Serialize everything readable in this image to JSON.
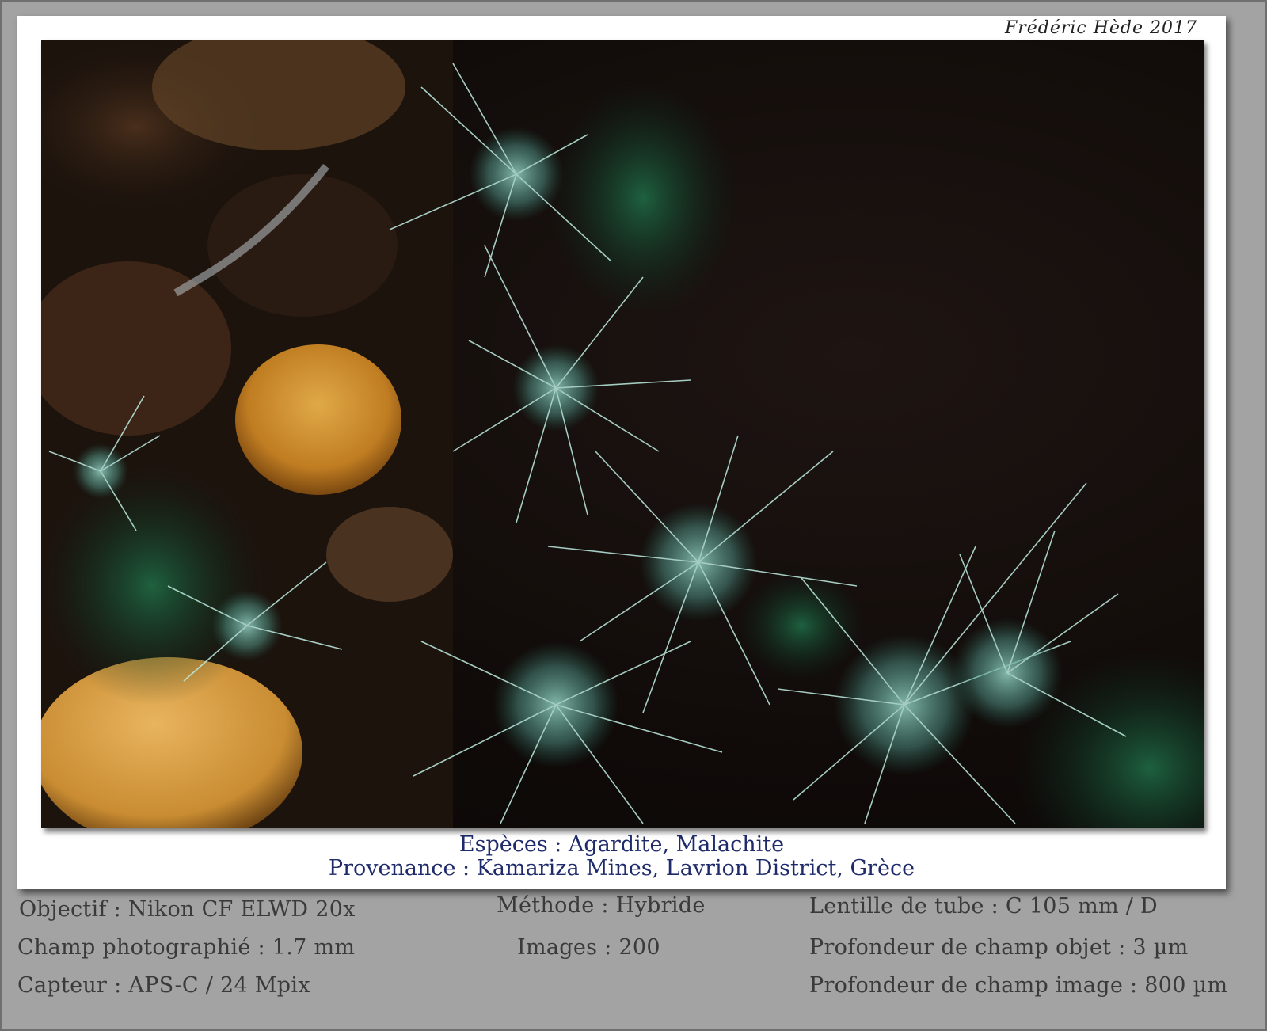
{
  "credit": "Frédéric Hède 2017",
  "photo": {
    "subject_icon": "mineral-photo",
    "accent_color": "#5fb3a3",
    "background_color": "#100b09"
  },
  "caption": {
    "species": "Espèces : Agardite, Malachite",
    "origin": "Provenance : Kamariza Mines, Lavrion District, Grèce"
  },
  "meta_left": {
    "objective": "Objectif : Nikon CF ELWD 20x",
    "field": "Champ photographié : 1.7 mm",
    "sensor": "Capteur : APS-C / 24 Mpix"
  },
  "meta_center": {
    "method": "Méthode : Hybride",
    "images": "Images : 200"
  },
  "meta_right": {
    "tube_lens": "Lentille de tube : C 105 mm / D",
    "object_dof": "Profondeur de champ objet : 3 µm",
    "image_dof": "Profondeur de champ image : 800 µm"
  }
}
